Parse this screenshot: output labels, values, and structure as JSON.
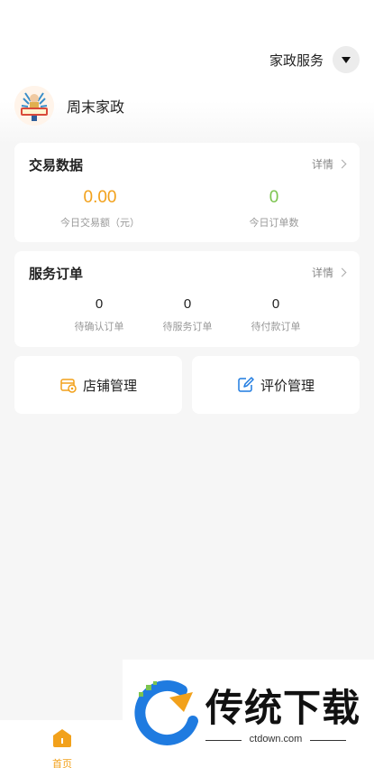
{
  "header": {
    "service_label": "家政服务"
  },
  "shop": {
    "name": "周末家政",
    "avatar_text": "家政服务"
  },
  "trade_card": {
    "title": "交易数据",
    "detail": "详情",
    "stats": [
      {
        "value": "0.00",
        "label": "今日交易额（元）",
        "color": "#f2a11b"
      },
      {
        "value": "0",
        "label": "今日订单数",
        "color": "#7cc44f"
      }
    ]
  },
  "order_card": {
    "title": "服务订单",
    "detail": "详情",
    "items": [
      {
        "value": "0",
        "label": "待确认订单"
      },
      {
        "value": "0",
        "label": "待服务订单"
      },
      {
        "value": "0",
        "label": "待付款订单"
      }
    ]
  },
  "actions": {
    "store": {
      "label": "店铺管理",
      "icon": "store-gear-icon"
    },
    "review": {
      "label": "评价管理",
      "icon": "edit-note-icon"
    }
  },
  "tabbar": {
    "home_label": "首页"
  },
  "watermark": {
    "brand": "传统下载",
    "url": "ctdown.com"
  },
  "colors": {
    "accent": "#f2a11b",
    "green": "#7cc44f",
    "blue": "#1f7be0"
  }
}
